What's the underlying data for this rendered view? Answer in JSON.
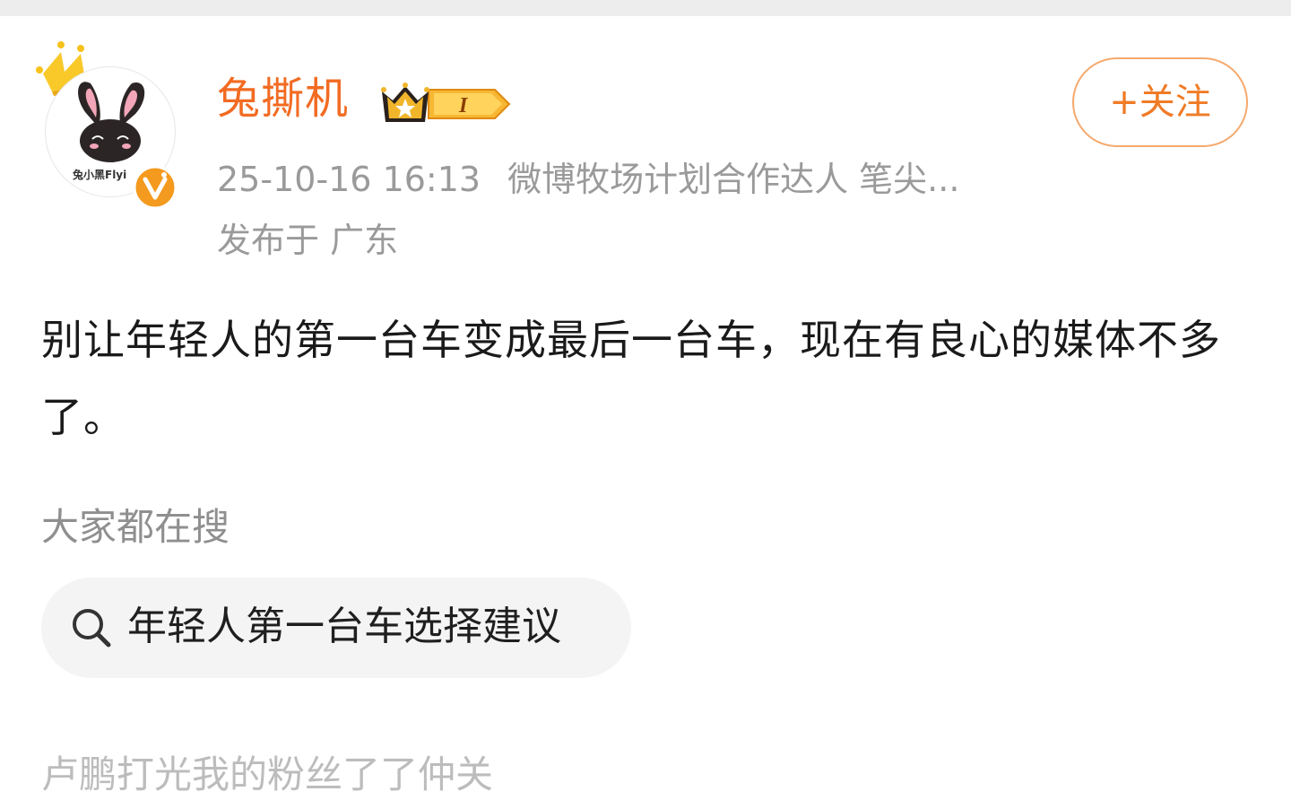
{
  "post": {
    "username": "兔撕机",
    "avatar_caption": "兔小黑Flyi",
    "vip_level": "I",
    "timestamp": "25-10-16 16:13",
    "source": "微博牧场计划合作达人 笔尖...",
    "location": "发布于 广东",
    "follow_label": "+关注",
    "content": "别让年轻人的第一台车变成最后一台车，现在有良心的媒体不多了。",
    "search_section_title": "大家都在搜",
    "search_suggestion": "年轻人第一台车选择建议",
    "partial_next_line": "卢鹏打光我的粉丝了了仲关"
  },
  "colors": {
    "username": "#f26b22",
    "follow_border": "#f5a96d",
    "verified": "#f39a1f",
    "meta_text": "#9a9a9a"
  },
  "icons": [
    "crown-icon",
    "verified-icon",
    "vip-crown-icon",
    "search-icon"
  ]
}
